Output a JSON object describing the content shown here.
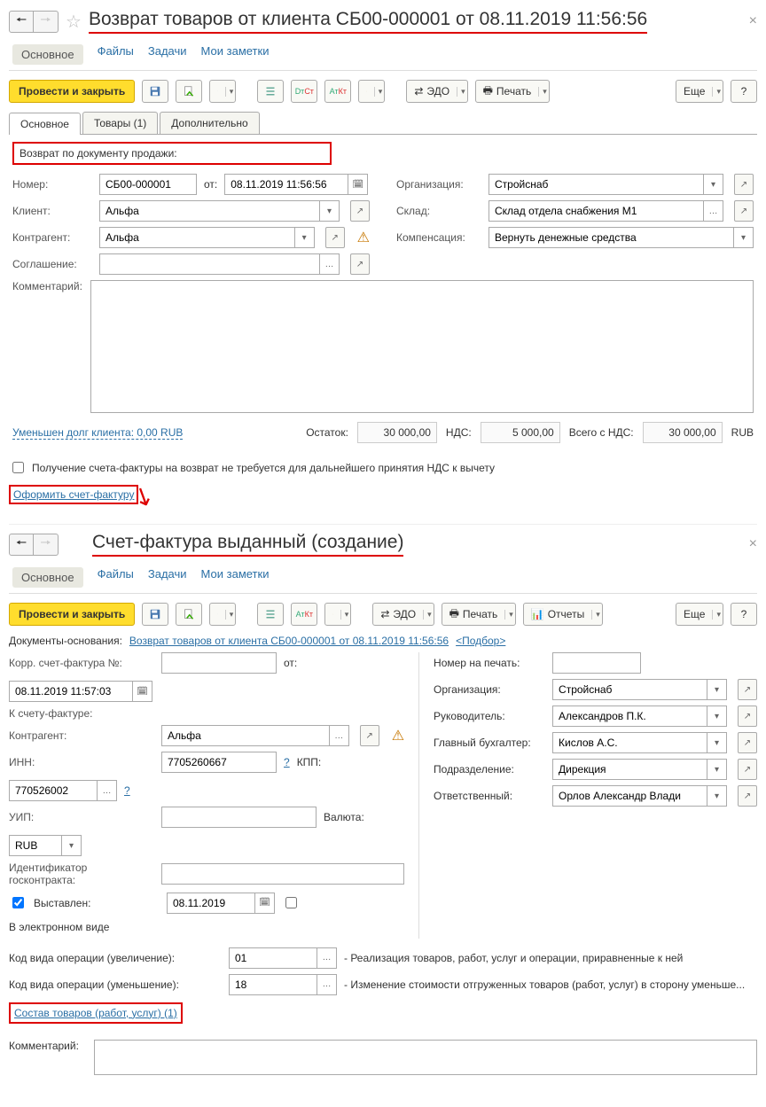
{
  "doc1": {
    "title": "Возврат товаров от клиента СБ00-000001 от 08.11.2019 11:56:56",
    "navTabs": {
      "main": "Основное",
      "files": "Файлы",
      "tasks": "Задачи",
      "notes": "Мои заметки"
    },
    "toolbar": {
      "postClose": "Провести и закрыть",
      "edo": "ЭДО",
      "print": "Печать",
      "more": "Еще",
      "help": "?"
    },
    "tabs": {
      "main": "Основное",
      "goods": "Товары (1)",
      "extra": "Дополнительно"
    },
    "returnByDoc": "Возврат по документу продажи:",
    "labels": {
      "number": "Номер:",
      "from": "от:",
      "client": "Клиент:",
      "contragent": "Контрагент:",
      "agreement": "Соглашение:",
      "comment": "Комментарий:",
      "org": "Организация:",
      "warehouse": "Склад:",
      "compensation": "Компенсация:"
    },
    "fields": {
      "number": "СБ00-000001",
      "date": "08.11.2019 11:56:56",
      "client": "Альфа",
      "contragent": "Альфа",
      "agreement": "",
      "comment": "",
      "org": "Стройснаб",
      "warehouse": "Склад отдела снабжения М1",
      "compensation": "Вернуть денежные средства"
    },
    "debtLink": "Уменьшен долг клиента: 0,00 RUB",
    "totals": {
      "remainLabel": "Остаток:",
      "remain": "30 000,00",
      "vatLabel": "НДС:",
      "vat": "5 000,00",
      "totalLabel": "Всего с НДС:",
      "total": "30 000,00",
      "currency": "RUB"
    },
    "noInvoiceCheck": "Получение счета-фактуры на возврат не требуется для дальнейшего принятия НДС к вычету",
    "issueInvoiceLink": "Оформить счет-фактуру"
  },
  "doc2": {
    "title": "Счет-фактура выданный (создание)",
    "navTabs": {
      "main": "Основное",
      "files": "Файлы",
      "tasks": "Задачи",
      "notes": "Мои заметки"
    },
    "toolbar": {
      "postClose": "Провести и закрыть",
      "edo": "ЭДО",
      "print": "Печать",
      "reports": "Отчеты",
      "more": "Еще",
      "help": "?"
    },
    "basisLabel": "Документы-основания:",
    "basisLink": "Возврат товаров от клиента СБ00-000001 от 08.11.2019 11:56:56",
    "pickLink": "<Подбор>",
    "labels": {
      "corrNo": "Корр. счет-фактура №:",
      "from": "от:",
      "toInvoice": "К счету-фактуре:",
      "contragent": "Контрагент:",
      "inn": "ИНН:",
      "kpp": "КПП:",
      "uip": "УИП:",
      "currency": "Валюта:",
      "contractId": "Идентификатор госконтракта:",
      "issued": "Выставлен:",
      "electronic": "В электронном виде",
      "opIncrease": "Код вида операции (увеличение):",
      "opDecrease": "Код вида операции (уменьшение):",
      "printNo": "Номер на печать:",
      "org": "Организация:",
      "director": "Руководитель:",
      "accountant": "Главный бухгалтер:",
      "dept": "Подразделение:",
      "responsible": "Ответственный:",
      "comment": "Комментарий:"
    },
    "fields": {
      "corrNo": "",
      "date": "08.11.2019 11:57:03",
      "contragent": "Альфа",
      "inn": "7705260667",
      "kpp": "770526002",
      "uip": "",
      "currency": "RUB",
      "contractId": "",
      "issued": "08.11.2019",
      "opInc": "01",
      "opIncDesc": "- Реализация товаров, работ, услуг и операции, приравненные к ней",
      "opDec": "18",
      "opDecDesc": "- Изменение стоимости отгруженных товаров (работ, услуг) в сторону уменьше...",
      "printNo": "",
      "org": "Стройснаб",
      "director": "Александров П.К.",
      "accountant": "Кислов А.С.",
      "dept": "Дирекция",
      "responsible": "Орлов Александр Влади"
    },
    "goodsLink": "Состав товаров (работ, услуг) (1)"
  }
}
